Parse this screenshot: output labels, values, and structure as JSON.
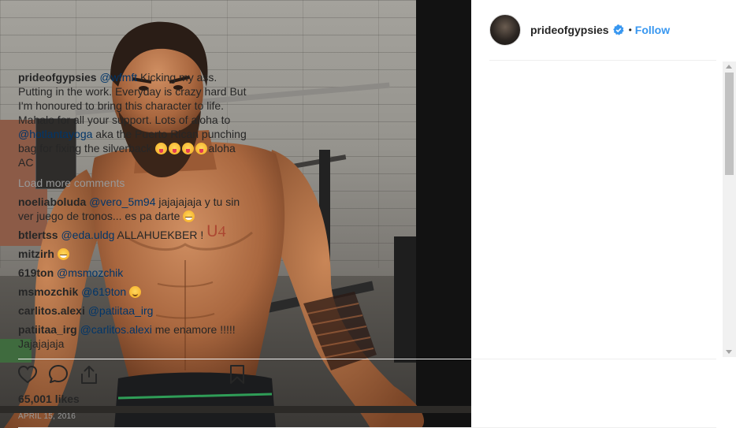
{
  "post": {
    "username": "prideofgypsies",
    "follow_label": "Follow",
    "separator": "•",
    "caption": {
      "username": "prideofgypsies",
      "mention": "@wfmft",
      "text1": " Kicking my ass. Putting in the work. Everyday is crazy hard But I'm honoured to bring this character to life. Mahalo for all your support. Lots of aloha to ",
      "mention2": "@hotlantayoga",
      "text2": " aka the Puerto Rican punching bag for fixing the silverback ",
      "text3": "aloha AC"
    },
    "load_more": "Load more comments",
    "comments": [
      {
        "user": "noeliaboluda",
        "mention": "@vero_5m94",
        "text": " jajajajaja y tu sin ver juego de tronos... es pa darte "
      },
      {
        "user": "btlertss",
        "mention": "@eda.uldg",
        "text": " ALLAHUEKBER !"
      },
      {
        "user": "mitzirh",
        "mention": "",
        "text": ""
      },
      {
        "user": "619ton",
        "mention": "@msmozchik",
        "text": ""
      },
      {
        "user": "msmozchik",
        "mention": "@619ton",
        "text": ""
      },
      {
        "user": "carlitos.alexi",
        "mention": "@patiitaa_irg",
        "text": ""
      },
      {
        "user": "patiitaa_irg",
        "mention": "@carlitos.alexi",
        "text": " me enamore !!!!! Jajajajaja"
      }
    ],
    "likes": "65,001 likes",
    "date": "APRIL 15, 2016"
  },
  "colors": {
    "link": "#3897f0",
    "mention": "#003569",
    "muted": "#999999",
    "text": "#262626"
  },
  "icons": {
    "verified": "verified-badge-icon",
    "like": "heart-icon",
    "comment": "comment-bubble-icon",
    "share": "share-icon",
    "save": "bookmark-icon"
  }
}
